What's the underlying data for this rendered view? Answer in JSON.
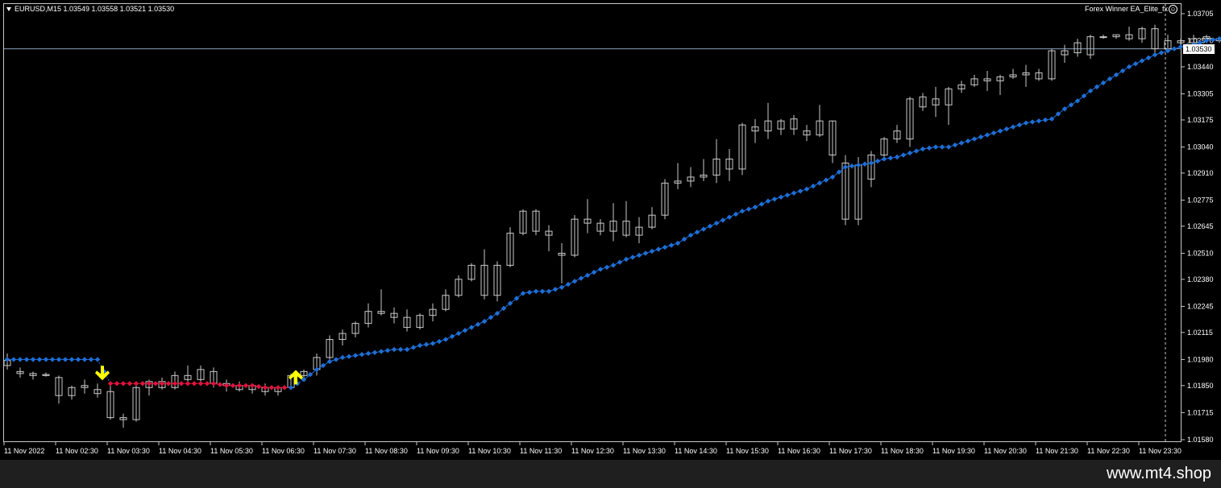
{
  "header": {
    "symbol_line": "EURUSD,M15  1.03549 1.03558 1.03521 1.03530",
    "ea_name": "Forex Winner EA_Elite_fx",
    "smiley_glyph": "☺"
  },
  "current_price_label": "1.03530",
  "footer": {
    "site": "www.mt4.shop"
  },
  "colors": {
    "bullish_dots": "#1e6fd8",
    "bearish_dots": "#e0133c",
    "signal_arrows": "#ffff00",
    "candles": "#c8c8c8",
    "background": "#000000"
  },
  "chart_data": {
    "type": "candlestick",
    "symbol": "EURUSD",
    "timeframe": "M15",
    "grid": false,
    "y_ticks": [
      "1.03705",
      "1.03570",
      "1.03440",
      "1.03305",
      "1.03175",
      "1.03040",
      "1.02910",
      "1.02775",
      "1.02645",
      "1.02510",
      "1.02380",
      "1.02245",
      "1.02115",
      "1.01980",
      "1.01850",
      "1.01715",
      "1.01580"
    ],
    "y_range": [
      1.0158,
      1.03705
    ],
    "x_labels": [
      "11 Nov 2022",
      "11 Nov 02:30",
      "11 Nov 03:30",
      "11 Nov 04:30",
      "11 Nov 05:30",
      "11 Nov 06:30",
      "11 Nov 07:30",
      "11 Nov 08:30",
      "11 Nov 09:30",
      "11 Nov 10:30",
      "11 Nov 11:30",
      "11 Nov 12:30",
      "11 Nov 13:30",
      "11 Nov 14:30",
      "11 Nov 15:30",
      "11 Nov 16:30",
      "11 Nov 17:30",
      "11 Nov 18:30",
      "11 Nov 19:30",
      "11 Nov 20:30",
      "11 Nov 21:30",
      "11 Nov 22:30",
      "11 Nov 23:30"
    ],
    "candles": [
      {
        "o": 1.0195,
        "h": 1.0201,
        "l": 1.0193,
        "c": 1.01975
      },
      {
        "o": 1.0192,
        "h": 1.0194,
        "l": 1.0189,
        "c": 1.0191
      },
      {
        "o": 1.0191,
        "h": 1.0192,
        "l": 1.0188,
        "c": 1.019
      },
      {
        "o": 1.019,
        "h": 1.01915,
        "l": 1.01895,
        "c": 1.01905
      },
      {
        "o": 1.0189,
        "h": 1.019,
        "l": 1.0176,
        "c": 1.018
      },
      {
        "o": 1.018,
        "h": 1.0185,
        "l": 1.0178,
        "c": 1.0184
      },
      {
        "o": 1.0184,
        "h": 1.0188,
        "l": 1.0181,
        "c": 1.0185
      },
      {
        "o": 1.0183,
        "h": 1.0186,
        "l": 1.0179,
        "c": 1.0181
      },
      {
        "o": 1.0182,
        "h": 1.0186,
        "l": 1.0168,
        "c": 1.0169
      },
      {
        "o": 1.0169,
        "h": 1.0171,
        "l": 1.0164,
        "c": 1.0168
      },
      {
        "o": 1.0168,
        "h": 1.0186,
        "l": 1.0167,
        "c": 1.0184
      },
      {
        "o": 1.0184,
        "h": 1.0188,
        "l": 1.018,
        "c": 1.0187
      },
      {
        "o": 1.0187,
        "h": 1.0189,
        "l": 1.0183,
        "c": 1.0184
      },
      {
        "o": 1.0184,
        "h": 1.0192,
        "l": 1.0183,
        "c": 1.019
      },
      {
        "o": 1.019,
        "h": 1.0195,
        "l": 1.0186,
        "c": 1.0188
      },
      {
        "o": 1.0188,
        "h": 1.0195,
        "l": 1.0187,
        "c": 1.0193
      },
      {
        "o": 1.0192,
        "h": 1.0194,
        "l": 1.0184,
        "c": 1.0186
      },
      {
        "o": 1.0186,
        "h": 1.0188,
        "l": 1.0182,
        "c": 1.0185
      },
      {
        "o": 1.0185,
        "h": 1.0187,
        "l": 1.0182,
        "c": 1.0183
      },
      {
        "o": 1.0183,
        "h": 1.0186,
        "l": 1.0181,
        "c": 1.0185
      },
      {
        "o": 1.0184,
        "h": 1.0186,
        "l": 1.018,
        "c": 1.0182
      },
      {
        "o": 1.0182,
        "h": 1.0185,
        "l": 1.018,
        "c": 1.0184
      },
      {
        "o": 1.0184,
        "h": 1.0191,
        "l": 1.0183,
        "c": 1.019
      },
      {
        "o": 1.019,
        "h": 1.0193,
        "l": 1.0188,
        "c": 1.0192
      },
      {
        "o": 1.0193,
        "h": 1.0201,
        "l": 1.019,
        "c": 1.0199
      },
      {
        "o": 1.0199,
        "h": 1.021,
        "l": 1.0198,
        "c": 1.0208
      },
      {
        "o": 1.0208,
        "h": 1.0213,
        "l": 1.0205,
        "c": 1.0211
      },
      {
        "o": 1.0211,
        "h": 1.0217,
        "l": 1.0209,
        "c": 1.0216
      },
      {
        "o": 1.0216,
        "h": 1.0226,
        "l": 1.0214,
        "c": 1.0222
      },
      {
        "o": 1.0222,
        "h": 1.0233,
        "l": 1.022,
        "c": 1.0221
      },
      {
        "o": 1.0221,
        "h": 1.0224,
        "l": 1.0216,
        "c": 1.0219
      },
      {
        "o": 1.0219,
        "h": 1.0223,
        "l": 1.0212,
        "c": 1.0214
      },
      {
        "o": 1.0214,
        "h": 1.0221,
        "l": 1.0213,
        "c": 1.022
      },
      {
        "o": 1.022,
        "h": 1.0226,
        "l": 1.0217,
        "c": 1.0223
      },
      {
        "o": 1.0223,
        "h": 1.0233,
        "l": 1.0222,
        "c": 1.023
      },
      {
        "o": 1.023,
        "h": 1.024,
        "l": 1.0229,
        "c": 1.0238
      },
      {
        "o": 1.0238,
        "h": 1.0246,
        "l": 1.0237,
        "c": 1.0245
      },
      {
        "o": 1.0245,
        "h": 1.0253,
        "l": 1.0228,
        "c": 1.023
      },
      {
        "o": 1.023,
        "h": 1.0247,
        "l": 1.0227,
        "c": 1.0245
      },
      {
        "o": 1.0245,
        "h": 1.0264,
        "l": 1.0244,
        "c": 1.0261
      },
      {
        "o": 1.0261,
        "h": 1.0273,
        "l": 1.026,
        "c": 1.0272
      },
      {
        "o": 1.0272,
        "h": 1.0273,
        "l": 1.026,
        "c": 1.0262
      },
      {
        "o": 1.0262,
        "h": 1.0265,
        "l": 1.0252,
        "c": 1.026
      },
      {
        "o": 1.0251,
        "h": 1.0256,
        "l": 1.0236,
        "c": 1.025
      },
      {
        "o": 1.025,
        "h": 1.027,
        "l": 1.0249,
        "c": 1.0268
      },
      {
        "o": 1.0268,
        "h": 1.0278,
        "l": 1.0261,
        "c": 1.0266
      },
      {
        "o": 1.0266,
        "h": 1.0268,
        "l": 1.026,
        "c": 1.0262
      },
      {
        "o": 1.0262,
        "h": 1.0276,
        "l": 1.0257,
        "c": 1.0267
      },
      {
        "o": 1.0267,
        "h": 1.0277,
        "l": 1.0259,
        "c": 1.026
      },
      {
        "o": 1.026,
        "h": 1.0269,
        "l": 1.0256,
        "c": 1.0264
      },
      {
        "o": 1.0264,
        "h": 1.0274,
        "l": 1.0263,
        "c": 1.027
      },
      {
        "o": 1.027,
        "h": 1.0288,
        "l": 1.0268,
        "c": 1.0286
      },
      {
        "o": 1.0286,
        "h": 1.0296,
        "l": 1.0283,
        "c": 1.0287
      },
      {
        "o": 1.0287,
        "h": 1.0294,
        "l": 1.0284,
        "c": 1.0289
      },
      {
        "o": 1.0289,
        "h": 1.0298,
        "l": 1.0287,
        "c": 1.029
      },
      {
        "o": 1.029,
        "h": 1.0308,
        "l": 1.0286,
        "c": 1.0298
      },
      {
        "o": 1.0298,
        "h": 1.0303,
        "l": 1.0287,
        "c": 1.0293
      },
      {
        "o": 1.0293,
        "h": 1.0316,
        "l": 1.029,
        "c": 1.0315
      },
      {
        "o": 1.0314,
        "h": 1.0318,
        "l": 1.0306,
        "c": 1.0312
      },
      {
        "o": 1.0312,
        "h": 1.0326,
        "l": 1.0308,
        "c": 1.0317
      },
      {
        "o": 1.0317,
        "h": 1.0318,
        "l": 1.031,
        "c": 1.0313
      },
      {
        "o": 1.0313,
        "h": 1.032,
        "l": 1.031,
        "c": 1.0318
      },
      {
        "o": 1.0312,
        "h": 1.0315,
        "l": 1.0307,
        "c": 1.031
      },
      {
        "o": 1.031,
        "h": 1.0325,
        "l": 1.0309,
        "c": 1.0317
      },
      {
        "o": 1.0317,
        "h": 1.0317,
        "l": 1.0296,
        "c": 1.03
      },
      {
        "o": 1.0296,
        "h": 1.03,
        "l": 1.0265,
        "c": 1.0268
      },
      {
        "o": 1.0295,
        "h": 1.0299,
        "l": 1.0265,
        "c": 1.0268
      },
      {
        "o": 1.0288,
        "h": 1.0302,
        "l": 1.0284,
        "c": 1.03
      },
      {
        "o": 1.03,
        "h": 1.0309,
        "l": 1.0299,
        "c": 1.0308
      },
      {
        "o": 1.0308,
        "h": 1.0315,
        "l": 1.0306,
        "c": 1.0312
      },
      {
        "o": 1.0308,
        "h": 1.0329,
        "l": 1.0304,
        "c": 1.0328
      },
      {
        "o": 1.0329,
        "h": 1.0331,
        "l": 1.0322,
        "c": 1.0324
      },
      {
        "o": 1.0325,
        "h": 1.0334,
        "l": 1.0319,
        "c": 1.0328
      },
      {
        "o": 1.0325,
        "h": 1.0334,
        "l": 1.0315,
        "c": 1.0333
      },
      {
        "o": 1.0333,
        "h": 1.0337,
        "l": 1.0331,
        "c": 1.0335
      },
      {
        "o": 1.0335,
        "h": 1.034,
        "l": 1.0334,
        "c": 1.0338
      },
      {
        "o": 1.0338,
        "h": 1.0342,
        "l": 1.0332,
        "c": 1.0337
      },
      {
        "o": 1.0337,
        "h": 1.034,
        "l": 1.033,
        "c": 1.0339
      },
      {
        "o": 1.0339,
        "h": 1.0343,
        "l": 1.0338,
        "c": 1.034
      },
      {
        "o": 1.034,
        "h": 1.0345,
        "l": 1.0334,
        "c": 1.0341
      },
      {
        "o": 1.0341,
        "h": 1.0343,
        "l": 1.0337,
        "c": 1.0338
      },
      {
        "o": 1.0338,
        "h": 1.0353,
        "l": 1.0337,
        "c": 1.0352
      },
      {
        "o": 1.0352,
        "h": 1.0355,
        "l": 1.0346,
        "c": 1.035
      },
      {
        "o": 1.0351,
        "h": 1.0358,
        "l": 1.0349,
        "c": 1.0356
      },
      {
        "o": 1.035,
        "h": 1.036,
        "l": 1.0348,
        "c": 1.0359
      },
      {
        "o": 1.0359,
        "h": 1.036,
        "l": 1.0358,
        "c": 1.0359
      },
      {
        "o": 1.0359,
        "h": 1.036,
        "l": 1.0358,
        "c": 1.036
      },
      {
        "o": 1.036,
        "h": 1.0364,
        "l": 1.0357,
        "c": 1.0358
      },
      {
        "o": 1.0358,
        "h": 1.0364,
        "l": 1.0356,
        "c": 1.0363
      },
      {
        "o": 1.0363,
        "h": 1.0365,
        "l": 1.035,
        "c": 1.0353
      },
      {
        "o": 1.0353,
        "h": 1.036,
        "l": 1.0351,
        "c": 1.0357
      },
      {
        "o": 1.0357,
        "h": 1.0358,
        "l": 1.0355,
        "c": 1.0356
      },
      {
        "o": 1.0356,
        "h": 1.036,
        "l": 1.0354,
        "c": 1.0358
      },
      {
        "o": 1.0358,
        "h": 1.036,
        "l": 1.0357,
        "c": 1.0359
      },
      {
        "o": 1.0358,
        "h": 1.0359,
        "l": 1.0356,
        "c": 1.0357
      },
      {
        "o": 1.0357,
        "h": 1.0359,
        "l": 1.0356,
        "c": 1.0358
      },
      {
        "o": 1.0358,
        "h": 1.0359,
        "l": 1.0356,
        "c": 1.0357
      },
      {
        "o": 1.03549,
        "h": 1.03558,
        "l": 1.03521,
        "c": 1.0353
      }
    ],
    "trail": {
      "bearish_range": [
        8,
        22
      ],
      "values": [
        1.0198,
        1.0198,
        1.0198,
        1.0198,
        1.0198,
        1.0198,
        1.0198,
        1.0198,
        1.0186,
        1.0186,
        1.0186,
        1.0186,
        1.0186,
        1.0186,
        1.0186,
        1.0186,
        1.0186,
        1.0185,
        1.0185,
        1.0185,
        1.0184,
        1.0184,
        1.0184,
        1.0188,
        1.0193,
        1.0197,
        1.0199,
        1.02,
        1.0201,
        1.0202,
        1.0203,
        1.0203,
        1.0205,
        1.0206,
        1.0208,
        1.0211,
        1.0214,
        1.0217,
        1.0221,
        1.0226,
        1.0231,
        1.0232,
        1.0232,
        1.0234,
        1.0237,
        1.024,
        1.0243,
        1.0245,
        1.0248,
        1.025,
        1.0252,
        1.0254,
        1.0256,
        1.026,
        1.0263,
        1.0266,
        1.0269,
        1.0272,
        1.0274,
        1.0277,
        1.0279,
        1.0281,
        1.0283,
        1.0286,
        1.0289,
        1.0294,
        1.0295,
        1.0296,
        1.0298,
        1.0299,
        1.0301,
        1.0303,
        1.0304,
        1.0304,
        1.0306,
        1.0308,
        1.031,
        1.0312,
        1.0314,
        1.0316,
        1.0317,
        1.0318,
        1.0323,
        1.0327,
        1.0332,
        1.0336,
        1.034,
        1.0344,
        1.0347,
        1.035,
        1.0352,
        1.0354,
        1.0355,
        1.0357,
        1.0358,
        1.0359,
        1.036,
        1.0361
      ]
    },
    "signals": [
      {
        "index": 8,
        "direction": "down"
      },
      {
        "index": 23,
        "direction": "up"
      }
    ]
  }
}
